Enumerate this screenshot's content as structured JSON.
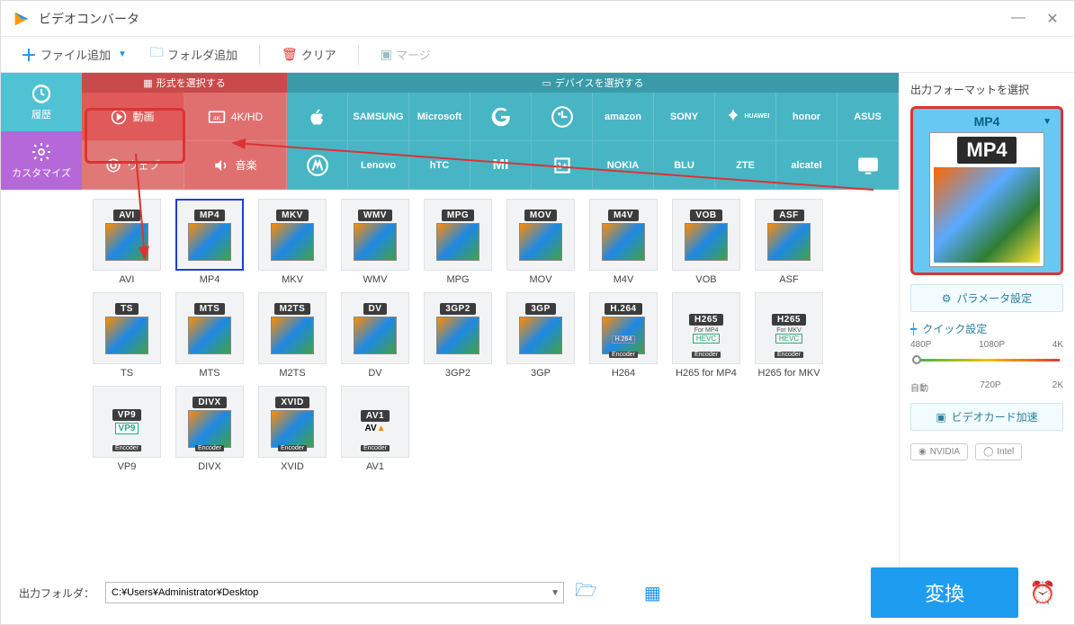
{
  "app": {
    "title": "ビデオコンバータ"
  },
  "toolbar": {
    "add_file": "ファイル追加",
    "add_folder": "フォルダ追加",
    "clear": "クリア",
    "merge": "マージ"
  },
  "left": {
    "history": "履歴",
    "customize": "カスタマイズ"
  },
  "category_tabs": {
    "format": "形式を選択する",
    "device": "デバイスを選択する"
  },
  "mode": {
    "video": "動画",
    "fourk": "4K/HD",
    "web": "ウェブ",
    "audio": "音楽"
  },
  "brands_row1": [
    "Apple",
    "SAMSUNG",
    "Microsoft",
    "Google",
    "LG",
    "amazon",
    "SONY",
    "HUAWEI",
    "honor",
    "ASUS"
  ],
  "brands_row2": [
    "Motorola",
    "Lenovo",
    "hTC",
    "Xiaomi",
    "OnePlus",
    "NOKIA",
    "BLU",
    "ZTE",
    "alcatel",
    "TV"
  ],
  "formats_row1": [
    {
      "badge": "AVI",
      "label": "AVI"
    },
    {
      "badge": "MP4",
      "label": "MP4",
      "selected": true
    },
    {
      "badge": "MKV",
      "label": "MKV"
    },
    {
      "badge": "WMV",
      "label": "WMV"
    },
    {
      "badge": "MPG",
      "label": "MPG"
    },
    {
      "badge": "MOV",
      "label": "MOV"
    },
    {
      "badge": "M4V",
      "label": "M4V"
    },
    {
      "badge": "VOB",
      "label": "VOB"
    },
    {
      "badge": "ASF",
      "label": "ASF"
    },
    {
      "badge": "TS",
      "label": "TS"
    }
  ],
  "formats_row2": [
    {
      "badge": "MTS",
      "label": "MTS"
    },
    {
      "badge": "M2TS",
      "label": "M2TS"
    },
    {
      "badge": "DV",
      "label": "DV"
    },
    {
      "badge": "3GP2",
      "label": "3GP2"
    },
    {
      "badge": "3GP",
      "label": "3GP"
    },
    {
      "badge": "H.264",
      "label": "H264",
      "sub": "Encoder"
    },
    {
      "badge": "H265",
      "label": "H265 for MP4",
      "sub": "Encoder",
      "mid": "For MP4",
      "hevc": "HEVC"
    },
    {
      "badge": "H265",
      "label": "H265 for MKV",
      "sub": "Encoder",
      "mid": "For MKV",
      "hevc": "HEVC"
    },
    {
      "badge": "VP9",
      "label": "VP9",
      "sub": "Encoder",
      "vp9": "VP9"
    },
    {
      "badge": "DIVX",
      "label": "DIVX",
      "sub": "Encoder"
    }
  ],
  "formats_row3": [
    {
      "badge": "XVID",
      "label": "XVID",
      "sub": "Encoder"
    },
    {
      "badge": "AV1",
      "label": "AV1",
      "sub": "Encoder",
      "av1": "AV1"
    }
  ],
  "right": {
    "title": "出力フォーマットを選択",
    "preview_format": "MP4",
    "param_btn": "パラメータ設定",
    "quick_title": "クイック設定",
    "ticks_top": [
      "480P",
      "1080P",
      "4K"
    ],
    "ticks_bottom": [
      "自動",
      "720P",
      "2K"
    ],
    "gpu_btn": "ビデオカード加速",
    "gpu_chips": [
      "NVIDIA",
      "Intel"
    ]
  },
  "bottom": {
    "out_label": "出力フォルダ：",
    "out_path": "C:¥Users¥Administrator¥Desktop",
    "convert": "変換"
  }
}
